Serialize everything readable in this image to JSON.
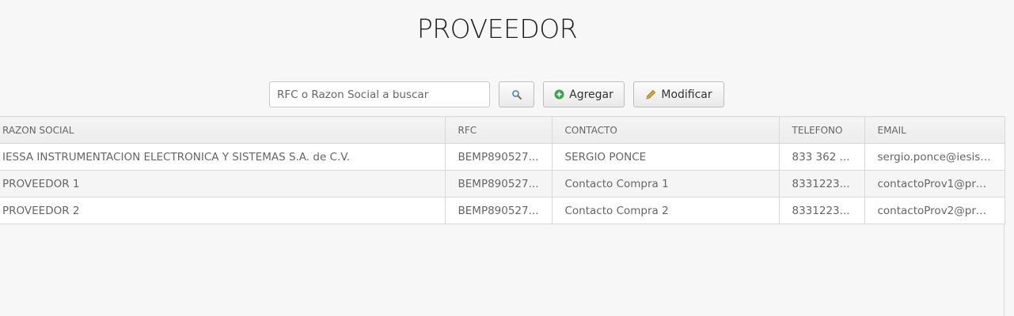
{
  "page": {
    "title": "PROVEEDOR"
  },
  "toolbar": {
    "search_placeholder": "RFC o Razon Social a buscar",
    "search_button_icon": "magnifier-icon",
    "add_label": "Agregar",
    "add_icon": "plus-circle-icon",
    "edit_label": "Modificar",
    "edit_icon": "pencil-icon"
  },
  "table": {
    "columns": [
      "RAZON SOCIAL",
      "RFC",
      "CONTACTO",
      "TELEFONO",
      "EMAIL"
    ],
    "rows": [
      {
        "razon_social": "IESSA INSTRUMENTACION ELECTRONICA Y SISTEMAS S.A. de C.V.",
        "rfc": "BEMP890527...",
        "contacto": "SERGIO PONCE",
        "telefono": "833 362 ...",
        "email": "sergio.ponce@iesis...."
      },
      {
        "razon_social": "PROVEEDOR 1",
        "rfc": "BEMP890527...",
        "contacto": "Contacto Compra 1",
        "telefono": "8331223...",
        "email": "contactoProv1@prov..."
      },
      {
        "razon_social": "PROVEEDOR 2",
        "rfc": "BEMP890527...",
        "contacto": "Contacto Compra 2",
        "telefono": "8331223...",
        "email": "contactoProv2@prov..."
      }
    ]
  },
  "colors": {
    "accent_green": "#3aa24a",
    "pencil_yellow": "#e3a52c"
  }
}
